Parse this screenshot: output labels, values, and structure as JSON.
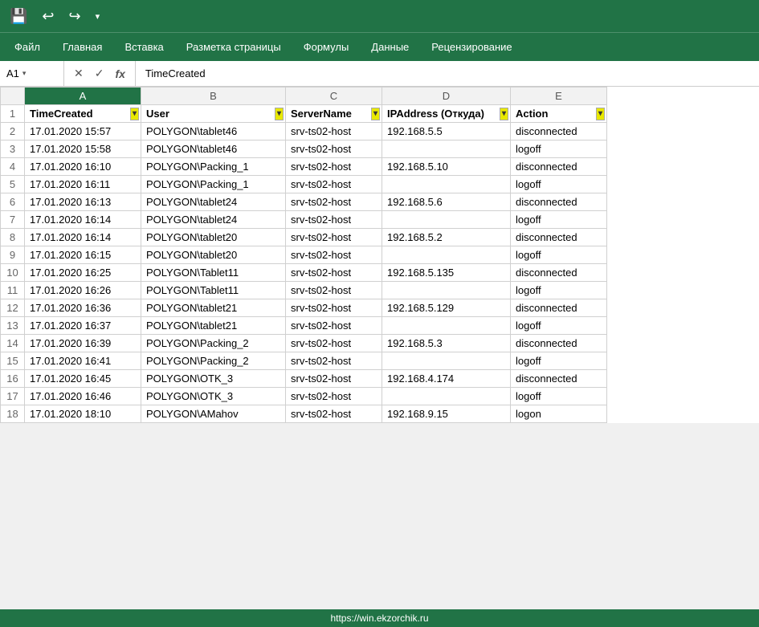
{
  "toolbar": {
    "save_icon": "💾",
    "undo_icon": "↩",
    "redo_icon": "↪",
    "more_icon": "▾"
  },
  "menubar": {
    "items": [
      "Файл",
      "Главная",
      "Вставка",
      "Разметка страницы",
      "Формулы",
      "Данные",
      "Рецензирование"
    ]
  },
  "formulabar": {
    "cell_ref": "A1",
    "formula_value": "TimeCreated",
    "cancel_icon": "✕",
    "confirm_icon": "✓",
    "fx_icon": "fx"
  },
  "columns": {
    "headers": [
      "",
      "A",
      "B",
      "C",
      "D",
      "E"
    ],
    "col_labels": [
      "TimeCreated",
      "User",
      "ServerName",
      "IPAddress (Откуда)",
      "Action"
    ]
  },
  "rows": [
    {
      "num": "2",
      "A": "17.01.2020 15:57",
      "B": "POLYGON\\tablet46",
      "C": "srv-ts02-host",
      "D": "192.168.5.5",
      "E": "disconnected"
    },
    {
      "num": "3",
      "A": "17.01.2020 15:58",
      "B": "POLYGON\\tablet46",
      "C": "srv-ts02-host",
      "D": "",
      "E": "logoff"
    },
    {
      "num": "4",
      "A": "17.01.2020 16:10",
      "B": "POLYGON\\Packing_1",
      "C": "srv-ts02-host",
      "D": "192.168.5.10",
      "E": "disconnected"
    },
    {
      "num": "5",
      "A": "17.01.2020 16:11",
      "B": "POLYGON\\Packing_1",
      "C": "srv-ts02-host",
      "D": "",
      "E": "logoff"
    },
    {
      "num": "6",
      "A": "17.01.2020 16:13",
      "B": "POLYGON\\tablet24",
      "C": "srv-ts02-host",
      "D": "192.168.5.6",
      "E": "disconnected"
    },
    {
      "num": "7",
      "A": "17.01.2020 16:14",
      "B": "POLYGON\\tablet24",
      "C": "srv-ts02-host",
      "D": "",
      "E": "logoff"
    },
    {
      "num": "8",
      "A": "17.01.2020 16:14",
      "B": "POLYGON\\tablet20",
      "C": "srv-ts02-host",
      "D": "192.168.5.2",
      "E": "disconnected"
    },
    {
      "num": "9",
      "A": "17.01.2020 16:15",
      "B": "POLYGON\\tablet20",
      "C": "srv-ts02-host",
      "D": "",
      "E": "logoff"
    },
    {
      "num": "10",
      "A": "17.01.2020 16:25",
      "B": "POLYGON\\Tablet11",
      "C": "srv-ts02-host",
      "D": "192.168.5.135",
      "E": "disconnected"
    },
    {
      "num": "11",
      "A": "17.01.2020 16:26",
      "B": "POLYGON\\Tablet11",
      "C": "srv-ts02-host",
      "D": "",
      "E": "logoff"
    },
    {
      "num": "12",
      "A": "17.01.2020 16:36",
      "B": "POLYGON\\tablet21",
      "C": "srv-ts02-host",
      "D": "192.168.5.129",
      "E": "disconnected"
    },
    {
      "num": "13",
      "A": "17.01.2020 16:37",
      "B": "POLYGON\\tablet21",
      "C": "srv-ts02-host",
      "D": "",
      "E": "logoff"
    },
    {
      "num": "14",
      "A": "17.01.2020 16:39",
      "B": "POLYGON\\Packing_2",
      "C": "srv-ts02-host",
      "D": "192.168.5.3",
      "E": "disconnected"
    },
    {
      "num": "15",
      "A": "17.01.2020 16:41",
      "B": "POLYGON\\Packing_2",
      "C": "srv-ts02-host",
      "D": "",
      "E": "logoff"
    },
    {
      "num": "16",
      "A": "17.01.2020 16:45",
      "B": "POLYGON\\OTK_3",
      "C": "srv-ts02-host",
      "D": "192.168.4.174",
      "E": "disconnected"
    },
    {
      "num": "17",
      "A": "17.01.2020 16:46",
      "B": "POLYGON\\OTK_3",
      "C": "srv-ts02-host",
      "D": "",
      "E": "logoff"
    },
    {
      "num": "18",
      "A": "17.01.2020 18:10",
      "B": "POLYGON\\AMahov",
      "C": "srv-ts02-host",
      "D": "192.168.9.15",
      "E": "logon"
    }
  ],
  "statusbar": {
    "url": "https://win.ekzorchik.ru"
  }
}
